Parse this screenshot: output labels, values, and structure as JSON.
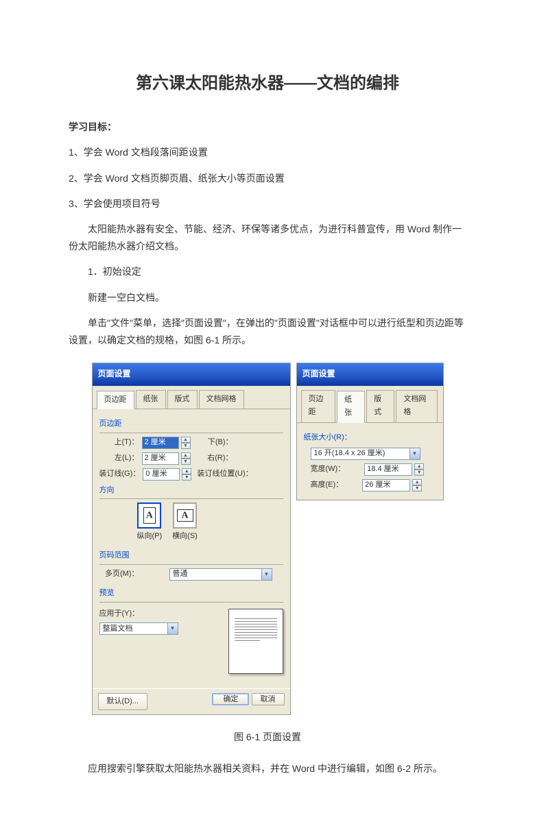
{
  "title": "第六课太阳能热水器——文档的编排",
  "section_objectives": "学习目标：",
  "objectives": {
    "o1": "1、学会 Word 文档段落间距设置",
    "o2": "2、学会 Word 文档页脚页眉、纸张大小等页面设置",
    "o3": "3、学会使用项目符号"
  },
  "paragraphs": {
    "intro": "太阳能热水器有安全、节能、经济、环保等诸多优点，为进行科普宣传，用 Word 制作一份太阳能热水器介绍文档。",
    "step1_head": "1．初始设定",
    "step1_p1": "新建一空白文档。",
    "step1_p2": "单击\"文件\"菜单，选择\"页面设置\"，在弹出的\"页面设置\"对话框中可以进行纸型和页边距等设置，以确定文档的规格，如图 6-1 所示。",
    "fig_caption": "图 6-1 页面设置",
    "after_fig": "应用搜索引擎获取太阳能热水器相关资料，并在 Word 中进行编辑，如图 6-2 所示。"
  },
  "dlg1": {
    "title": "页面设置",
    "tabs": {
      "t1": "页边距",
      "t2": "纸张",
      "t3": "版式",
      "t4": "文档网格"
    },
    "grp_margin": "页边距",
    "top_lbl": "上(T)：",
    "top_val": "2 厘米",
    "bottom_lbl": "下(B)：",
    "left_lbl": "左(L)：",
    "left_val": "2 厘米",
    "right_lbl": "右(R)：",
    "gutter_lbl": "装订线(G)：",
    "gutter_val": "0 厘米",
    "gutterpos_lbl": "装订线位置(U)：",
    "grp_orient": "方向",
    "portrait": "纵向(P)",
    "landscape": "横向(S)",
    "grp_pages": "页码范围",
    "multipage_lbl": "多页(M)：",
    "multipage_val": "普通",
    "grp_preview": "预览",
    "applyto_lbl": "应用于(Y)：",
    "applyto_val": "整篇文档",
    "btn_default": "默认(D)...",
    "btn_ok": "确定",
    "btn_cancel": "取消"
  },
  "dlg2": {
    "title": "页面设置",
    "tabs": {
      "t1": "页边距",
      "t2": "纸张",
      "t3": "版式",
      "t4": "文档网格"
    },
    "grp_size": "纸张大小(R)：",
    "size_val": "16 开(18.4 x 26 厘米)",
    "width_lbl": "宽度(W)：",
    "width_val": "18.4 厘米",
    "height_lbl": "高度(E)：",
    "height_val": "26 厘米"
  }
}
